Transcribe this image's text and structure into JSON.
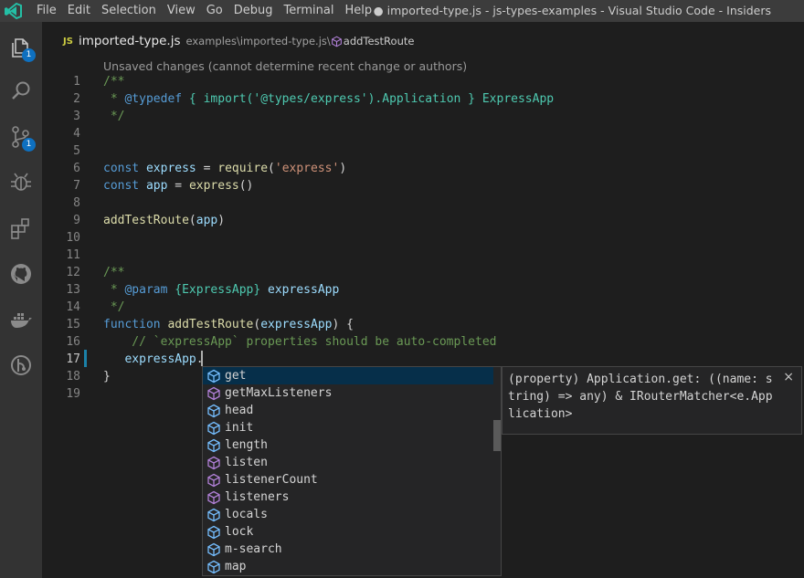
{
  "titlebar": {
    "menu": [
      "File",
      "Edit",
      "Selection",
      "View",
      "Go",
      "Debug",
      "Terminal",
      "Help"
    ],
    "window_title": "● imported-type.js - js-types-examples - Visual Studio Code - Insiders"
  },
  "activity": {
    "explorer_badge": "1",
    "scm_badge": "1",
    "icons": [
      "files-icon",
      "search-icon",
      "source-control-icon",
      "debug-icon",
      "extensions-icon",
      "github-icon",
      "docker-icon",
      "gitlens-icon"
    ]
  },
  "breadcrumb": {
    "lang_badge": "JS",
    "file": "imported-type.js",
    "path": "examples\\imported-type.js\\",
    "symbol": "addTestRoute"
  },
  "codelens": "Unsaved changes (cannot determine recent change or authors)",
  "lines": [
    {
      "n": "1",
      "tokens": [
        [
          "/**",
          "c-comment"
        ]
      ]
    },
    {
      "n": "2",
      "tokens": [
        [
          " * ",
          "c-comment"
        ],
        [
          "@typedef",
          "c-doctag"
        ],
        [
          " { ",
          "c-type"
        ],
        [
          "import('@types/express').Application",
          "c-type"
        ],
        [
          " } ",
          "c-type"
        ],
        [
          "ExpressApp",
          "c-type"
        ]
      ]
    },
    {
      "n": "3",
      "tokens": [
        [
          " */",
          "c-comment"
        ]
      ]
    },
    {
      "n": "4",
      "tokens": []
    },
    {
      "n": "5",
      "tokens": []
    },
    {
      "n": "6",
      "tokens": [
        [
          "const",
          "c-kw"
        ],
        [
          " ",
          "c-plain"
        ],
        [
          "express",
          "c-var"
        ],
        [
          " = ",
          "c-plain"
        ],
        [
          "require",
          "c-fn"
        ],
        [
          "(",
          "c-plain"
        ],
        [
          "'express'",
          "c-str"
        ],
        [
          ")",
          "c-plain"
        ]
      ]
    },
    {
      "n": "7",
      "tokens": [
        [
          "const",
          "c-kw"
        ],
        [
          " ",
          "c-plain"
        ],
        [
          "app",
          "c-var"
        ],
        [
          " = ",
          "c-plain"
        ],
        [
          "express",
          "c-fn"
        ],
        [
          "()",
          "c-plain"
        ]
      ]
    },
    {
      "n": "8",
      "tokens": []
    },
    {
      "n": "9",
      "tokens": [
        [
          "addTestRoute",
          "c-fn"
        ],
        [
          "(",
          "c-plain"
        ],
        [
          "app",
          "c-var"
        ],
        [
          ")",
          "c-plain"
        ]
      ]
    },
    {
      "n": "10",
      "tokens": []
    },
    {
      "n": "11",
      "tokens": []
    },
    {
      "n": "12",
      "tokens": [
        [
          "/**",
          "c-comment"
        ]
      ]
    },
    {
      "n": "13",
      "tokens": [
        [
          " * ",
          "c-comment"
        ],
        [
          "@param",
          "c-doctag"
        ],
        [
          " ",
          "c-comment"
        ],
        [
          "{ExpressApp}",
          "c-type"
        ],
        [
          " ",
          "c-comment"
        ],
        [
          "expressApp",
          "c-var"
        ]
      ]
    },
    {
      "n": "14",
      "tokens": [
        [
          " */",
          "c-comment"
        ]
      ]
    },
    {
      "n": "15",
      "tokens": [
        [
          "function",
          "c-kw"
        ],
        [
          " ",
          "c-plain"
        ],
        [
          "addTestRoute",
          "c-fn"
        ],
        [
          "(",
          "c-plain"
        ],
        [
          "expressApp",
          "c-var"
        ],
        [
          ") {",
          "c-plain"
        ]
      ]
    },
    {
      "n": "16",
      "tokens": [
        [
          "    // `expressApp` properties should be auto-completed",
          "c-comment"
        ]
      ]
    },
    {
      "n": "17",
      "tokens": [
        [
          "   ",
          "c-plain"
        ],
        [
          "expressApp",
          "c-var"
        ],
        [
          ".",
          "c-plain"
        ]
      ],
      "active": true
    },
    {
      "n": "18",
      "tokens": [
        [
          "}",
          "c-plain"
        ]
      ]
    },
    {
      "n": "19",
      "tokens": []
    }
  ],
  "suggest": {
    "items": [
      {
        "label": "get",
        "kind": "property",
        "selected": true
      },
      {
        "label": "getMaxListeners",
        "kind": "method"
      },
      {
        "label": "head",
        "kind": "property"
      },
      {
        "label": "init",
        "kind": "property"
      },
      {
        "label": "length",
        "kind": "property"
      },
      {
        "label": "listen",
        "kind": "method"
      },
      {
        "label": "listenerCount",
        "kind": "method"
      },
      {
        "label": "listeners",
        "kind": "method"
      },
      {
        "label": "locals",
        "kind": "property"
      },
      {
        "label": "lock",
        "kind": "property"
      },
      {
        "label": "m-search",
        "kind": "property"
      },
      {
        "label": "map",
        "kind": "property"
      }
    ],
    "details": "(property) Application.get: ((name: string) => any) & IRouterMatcher<e.Application>",
    "close_glyph": "×"
  },
  "colors": {
    "accent": "#0e70c0",
    "property_icon": "#75beff",
    "method_icon": "#b180d7"
  }
}
